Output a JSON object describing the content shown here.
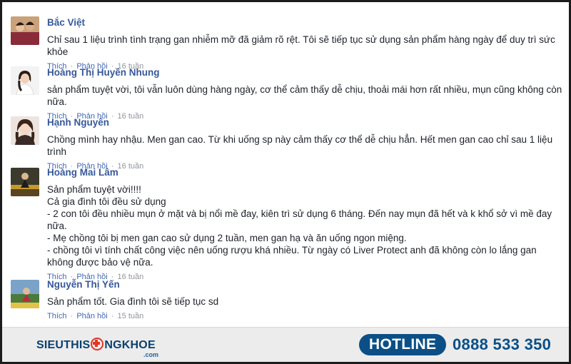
{
  "actions": {
    "like": "Thích",
    "reply": "Phản hồi",
    "separator": "·"
  },
  "comments": [
    {
      "author": "Bắc Việt",
      "text": "Chỉ sau 1 liệu trình tình trạng gan nhiễm mỡ đã giảm rõ rệt. Tôi sẽ tiếp tục sử dụng sản phẩm hàng ngày để duy trì sức khỏe",
      "time": "16 tuần"
    },
    {
      "author": "Hoàng Thị Huyền Nhung",
      "text": "sản phẩm tuyệt vời, tôi vẫn luôn dùng hàng ngày, cơ thể cảm thấy dễ chịu, thoải mái hơn rất nhiều, mụn cũng không còn nữa.",
      "time": "16 tuần"
    },
    {
      "author": "Hạnh Nguyên",
      "text": "Chồng mình hay nhậu. Men gan cao. Từ khi uống sp này cảm thấy cơ thể dễ chịu hẳn. Hết men gan cao chỉ sau 1 liệu trình",
      "time": "16 tuần"
    },
    {
      "author": "Hoàng Mai Lâm",
      "text": "Sản phẩm tuyệt vời!!!!\nCả gia đình tôi đều sử dụng\n- 2 con tôi đều nhiều mụn ở mặt và bị nổi mề đay, kiên trì sử dụng 6 tháng. Đến nay mụn đã hết và k khổ sở vì mề đay nữa.\n- Mẹ chồng tôi bị men gan cao sử dụng 2 tuần, men gan hạ và ăn uống ngon miệng.\n- chồng tôi vì tính chất công việc nên uống rượu khá nhiều. Từ ngày có Liver Protect anh đã không còn lo lắng gan không được bảo vệ nữa.",
      "time": "16 tuần"
    },
    {
      "author": "Nguyễn Thị Yến",
      "text": "Sản phẩm tốt. Gia đình tôi sẽ tiếp tục sd",
      "time": "15 tuần"
    }
  ],
  "footer": {
    "brand_left": "SIEUTHIS",
    "brand_right": "NGKHOE",
    "brand_sub": ".com",
    "hotline_label": "HOTLINE",
    "phone": "0888 533 350"
  },
  "colors": {
    "author": "#365899",
    "link": "#4267b2",
    "meta": "#90949c",
    "hotline_bg": "#0b4f86"
  }
}
